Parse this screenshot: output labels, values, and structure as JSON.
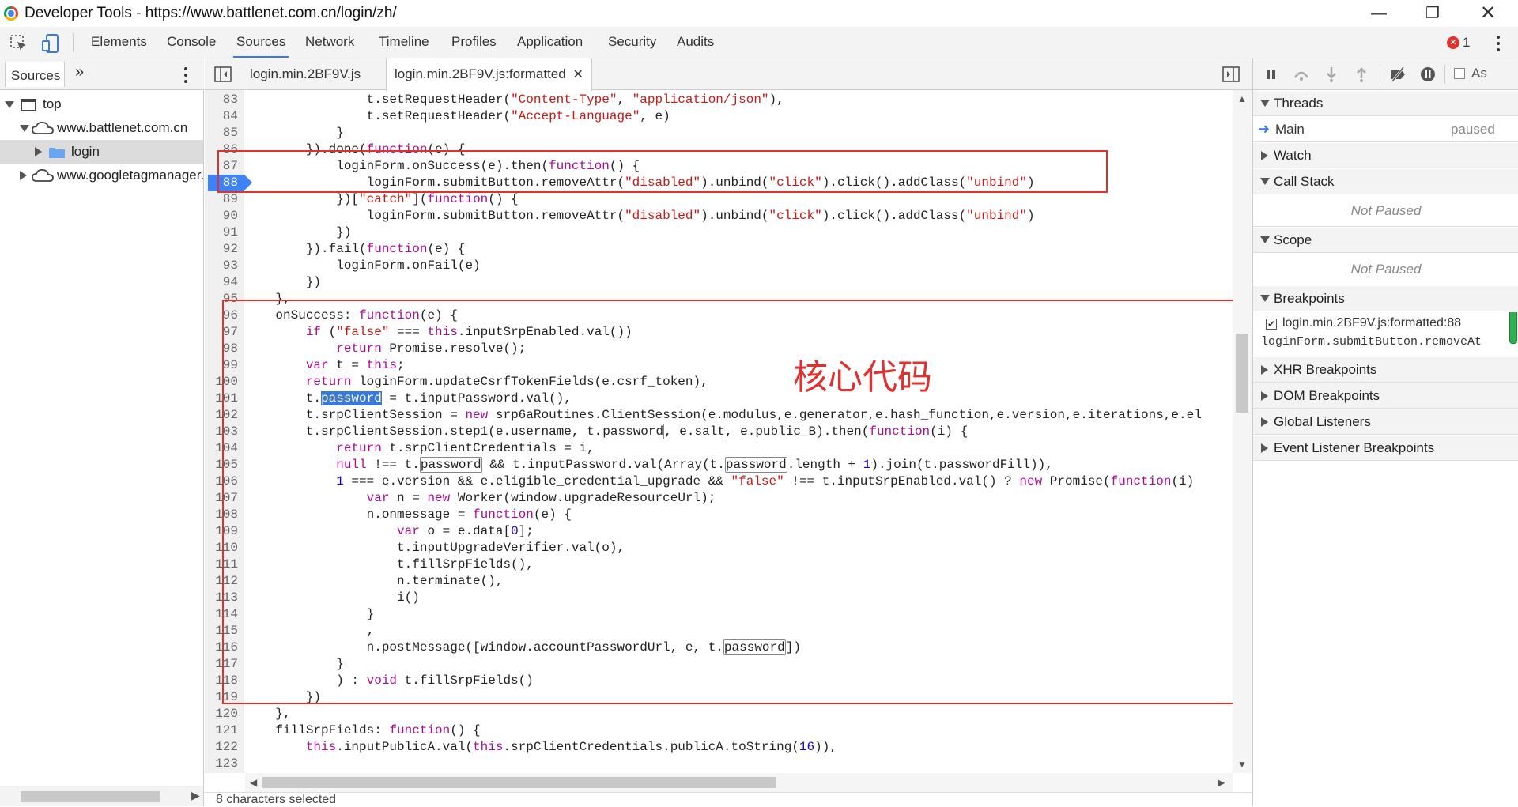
{
  "window": {
    "title": "Developer Tools - https://www.battlenet.com.cn/login/zh/"
  },
  "tabs": [
    "Elements",
    "Console",
    "Sources",
    "Network",
    "Timeline",
    "Profiles",
    "Application",
    "Security",
    "Audits"
  ],
  "active_tab": "Sources",
  "error_count": "1",
  "navigator": {
    "tab_label": "Sources",
    "items": [
      {
        "label": "top"
      },
      {
        "label": "www.battlenet.com.cn"
      },
      {
        "label": "login"
      },
      {
        "label": "www.googletagmanager.com"
      }
    ]
  },
  "editor": {
    "files": [
      "login.min.2BF9V.js",
      "login.min.2BF9V.js:formatted"
    ],
    "active_file": "login.min.2BF9V.js:formatted",
    "breakpoint_line": "88",
    "selected_text": "password",
    "annotation": "核心代码",
    "status": "8 characters selected",
    "line_numbers": [
      "83",
      "84",
      "85",
      "86",
      "87",
      "88",
      "89",
      "90",
      "91",
      "92",
      "93",
      "94",
      "95",
      "96",
      "97",
      "98",
      "99",
      "100",
      "101",
      "102",
      "103",
      "104",
      "105",
      "106",
      "107",
      "108",
      "109",
      "110",
      "111",
      "112",
      "113",
      "114",
      "115",
      "116",
      "117",
      "118",
      "119",
      "120",
      "121",
      "122",
      "123"
    ]
  },
  "debugger": {
    "threads": {
      "label": "Threads",
      "main": "Main",
      "state": "paused"
    },
    "watch": "Watch",
    "call_stack": {
      "label": "Call Stack",
      "empty": "Not Paused"
    },
    "scope": {
      "label": "Scope",
      "empty": "Not Paused"
    },
    "breakpoints": {
      "label": "Breakpoints",
      "item_location": "login.min.2BF9V.js:formatted:88",
      "item_code": "loginForm.submitButton.removeAt"
    },
    "xhr": "XHR Breakpoints",
    "dom": "DOM Breakpoints",
    "global": "Global Listeners",
    "event": "Event Listener Breakpoints",
    "async_label": "As"
  }
}
